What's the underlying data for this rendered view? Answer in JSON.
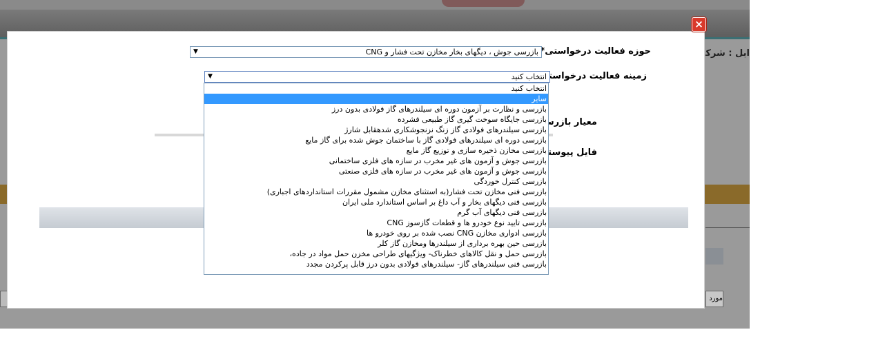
{
  "background": {
    "company_label": "ابل : شرکت",
    "button_label": "مورد"
  },
  "modal": {
    "close_icon": "×",
    "field_scope": {
      "label": "حوزه فعالیت درخواستی*:",
      "selected": "بازرسی جوش ، دیگهای بخار مخازن تحت فشار و CNG"
    },
    "field_area": {
      "label": "زمینه فعالیت درخواستی :",
      "selected": "انتخاب کنید"
    },
    "label_criteria": "معیار بازرسی",
    "label_attachment": "فایل پیوستی",
    "dropdown": {
      "selected_index": 1,
      "options": [
        "انتخاب کنید",
        "سایر",
        "بازرسی و نظارت بر آزمون دوره ای سیلندرهای گاز فولادی بدون درز",
        "بازرسی جایگاه سوخت گیری گاز طبیعی فشرده",
        "بازرسی سیلندرهای فولادی گاز زنگ نزنجوشکاری شدهقابل شارژ",
        "بازرسی دوره ای سیلندرهای فولادی گاز با ساختمان جوش شده برای گاز مایع",
        "بازرسی مخازن ذخیره سازی و توزیع گاز مایع",
        "بازرسی جوش و آزمون های غیر مخرب در سازه های فلزی ساختمانی",
        "بازرسی جوش و آزمون های غیر مخرب در سازه های فلزی صنعتی",
        "بازرسی کنترل خوردگی",
        "بازرسی فنی مخازن تحت فشار(به استثنای مخازن مشمول مقررات استانداردهای اجباری)",
        "بازرسی فنی دیگهای بخار و آب داغ بر اساس استاندارد ملی ایران",
        "بازرسی فنی دیگهای آب گرم",
        "بازرسی تایید نوع خودرو ها و قطعات گازسوز CNG",
        "بازرسی ادواری مخازن CNG نصب شده بر روی خودرو ها",
        "بازرسی حین بهره برداری از سیلندرها ومخازن گاز کلر",
        "بازرسی حمل و نقل کالاهای خطرناک- ویژگیهای طراحی مخزن حمل مواد در جاده،",
        "بازرسی فنی سیلندرهای گاز- سیلندرهای فولادی بدون درز قابل پرکردن مجدد"
      ]
    }
  }
}
